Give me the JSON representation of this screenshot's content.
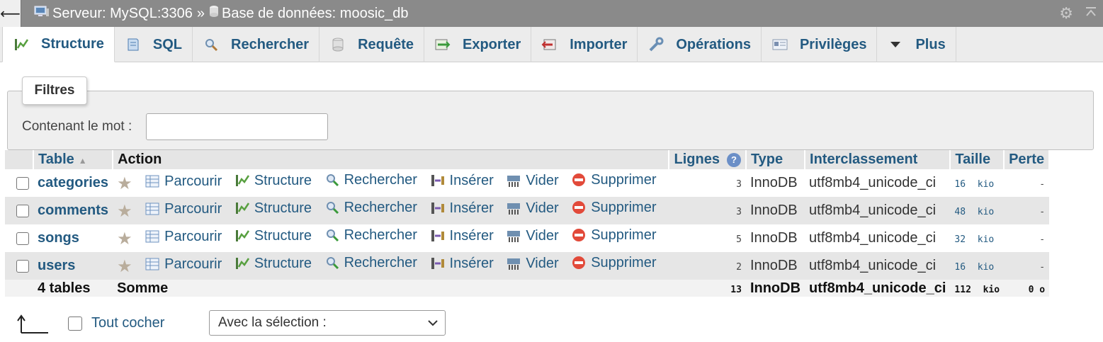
{
  "topbar": {
    "back_glyph": "⟵",
    "server": "Serveur: MySQL:3306",
    "separator": "»",
    "database": "Base de données: moosic_db",
    "icons": [
      "server-icon",
      "database-icon",
      "gear-icon",
      "collapse-icon"
    ]
  },
  "tabs": [
    {
      "label": "Structure",
      "icon": "structure-icon",
      "active": true
    },
    {
      "label": "SQL",
      "icon": "sql-icon"
    },
    {
      "label": "Rechercher",
      "icon": "search-icon"
    },
    {
      "label": "Requête",
      "icon": "query-icon"
    },
    {
      "label": "Exporter",
      "icon": "export-icon"
    },
    {
      "label": "Importer",
      "icon": "import-icon"
    },
    {
      "label": "Opérations",
      "icon": "wrench-icon"
    },
    {
      "label": "Privilèges",
      "icon": "privileges-icon"
    },
    {
      "label": "Plus",
      "icon": "caret-down-icon"
    }
  ],
  "filters": {
    "legend": "Filtres",
    "label": "Contenant le mot :",
    "value": ""
  },
  "table": {
    "headers": {
      "table": "Table",
      "action": "Action",
      "rows": "Lignes",
      "type": "Type",
      "collation": "Interclassement",
      "size": "Taille",
      "overhead": "Perte"
    },
    "actions": {
      "browse": "Parcourir",
      "structure": "Structure",
      "search": "Rechercher",
      "insert": "Insérer",
      "empty": "Vider",
      "drop": "Supprimer"
    },
    "rows": [
      {
        "name": "categories",
        "rows": "3",
        "type": "InnoDB",
        "collation": "utf8mb4_unicode_ci",
        "size": "16",
        "unit": "kio",
        "overhead": "-"
      },
      {
        "name": "comments",
        "rows": "3",
        "type": "InnoDB",
        "collation": "utf8mb4_unicode_ci",
        "size": "48",
        "unit": "kio",
        "overhead": "-"
      },
      {
        "name": "songs",
        "rows": "5",
        "type": "InnoDB",
        "collation": "utf8mb4_unicode_ci",
        "size": "32",
        "unit": "kio",
        "overhead": "-"
      },
      {
        "name": "users",
        "rows": "2",
        "type": "InnoDB",
        "collation": "utf8mb4_unicode_ci",
        "size": "16",
        "unit": "kio",
        "overhead": "-"
      }
    ],
    "footer": {
      "count": "4 tables",
      "label": "Somme",
      "rows": "13",
      "type": "InnoDB",
      "collation": "utf8mb4_unicode_ci",
      "size": "112",
      "unit": "kio",
      "overhead": "0 o"
    }
  },
  "bottom": {
    "check_all": "Tout cocher",
    "with_selected": "Avec la sélection :"
  }
}
